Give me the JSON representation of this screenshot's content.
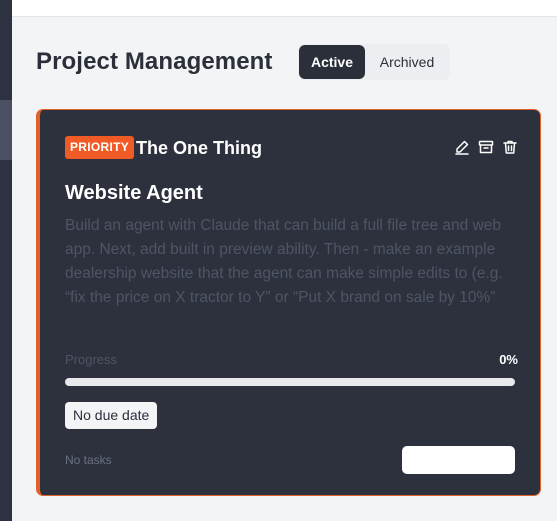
{
  "header": {
    "title": "Project Management",
    "tabs": [
      {
        "label": "Active",
        "selected": true
      },
      {
        "label": "Archived",
        "selected": false
      }
    ]
  },
  "card": {
    "badge": "PRIORITY",
    "subtitle": "The One Thing",
    "actions": [
      "pencil-icon",
      "archive-icon",
      "trash-icon"
    ],
    "title": "Website Agent",
    "description": "Build an agent with Claude that can build a full file tree and web app. Next, add built in preview ability. Then - make an example dealership website that the agent can make simple edits to (e.g. “fix the price on X tractor to Y” or “Put X brand on sale by 10%”",
    "progress_label": "Progress",
    "progress_text": "0%",
    "progress_fraction": 0,
    "due_date": "No due date",
    "tasks_label": "No tasks",
    "tasks_button_label": ""
  },
  "colors": {
    "accent": "#f05a24",
    "card_background": "#2d313e",
    "page_background": "#f3f4f6"
  }
}
